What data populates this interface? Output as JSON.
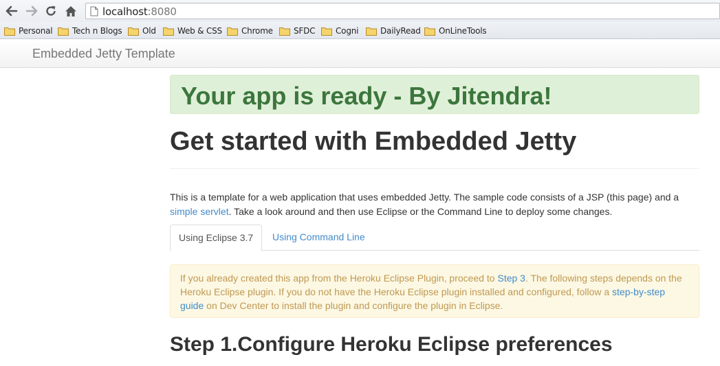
{
  "browser": {
    "url_host": "localhost",
    "url_port": ":8080",
    "icons": [
      "back-icon",
      "forward-icon",
      "reload-icon",
      "home-icon",
      "page-icon"
    ]
  },
  "bookmarks": [
    "Personal",
    "Tech n Blogs",
    "Old",
    "Web & CSS",
    "Chrome",
    "SFDC",
    "Cogni",
    "DailyRead",
    "OnLineTools"
  ],
  "navbar": {
    "brand": "Embedded Jetty Template"
  },
  "main": {
    "banner": "Your app is ready - By Jitendra!",
    "title": "Get started with Embedded Jetty",
    "intro_1": "This is a template for a web application that uses embedded Jetty. The sample code consists of a JSP (this page) and a",
    "intro_link": "simple servlet",
    "intro_2": ". Take a look around and then use Eclipse or the Command Line to deploy some changes.",
    "tabs": [
      "Using Eclipse 3.7",
      "Using Command Line"
    ],
    "notice_1": "If you already created this app from the Heroku Eclipse Plugin, proceed to ",
    "notice_link1": "Step 3",
    "notice_2": ". The following steps depends on the Heroku Eclipse plugin. If you do not have the Heroku Eclipse plugin installed and configured, follow a ",
    "notice_link2": "step-by-step guide",
    "notice_3": " on Dev Center to install the plugin and configure the plugin in Eclipse.",
    "step_heading": "Step 1.Configure Heroku Eclipse preferences"
  },
  "colors": {
    "success_bg": "#dff0d8",
    "success_text": "#3c763d",
    "warning_bg": "#fcf8e3",
    "warning_text": "#c09853",
    "link": "#428bca",
    "folder": "#e8c25a"
  }
}
